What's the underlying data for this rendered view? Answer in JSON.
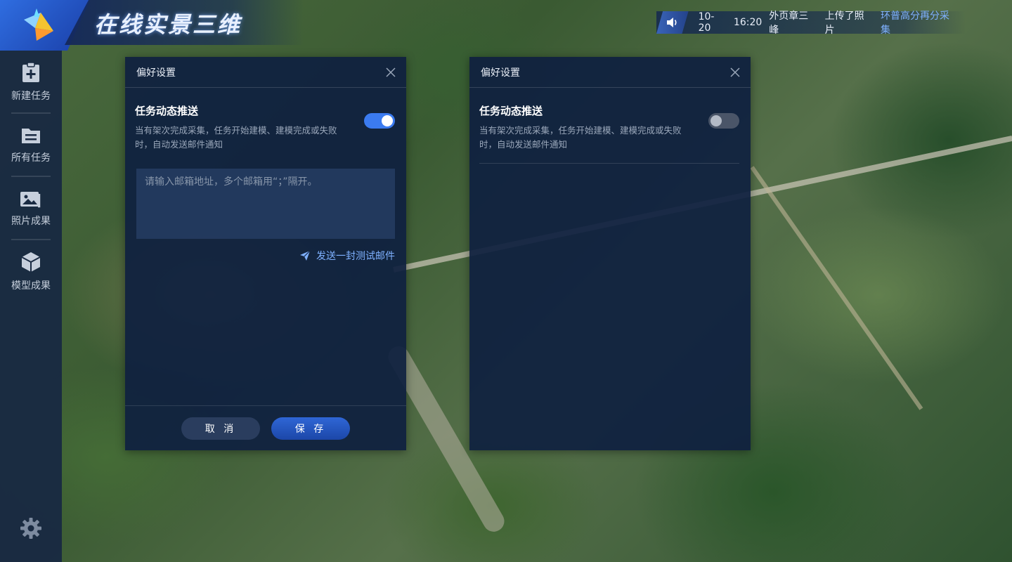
{
  "app": {
    "title": "在线实景三维"
  },
  "notice": {
    "date": "10-20",
    "time": "16:20",
    "user": "外页章三峰",
    "action": "上传了照片",
    "project": "环普高分再分采集"
  },
  "sidebar": {
    "items": [
      {
        "label": "新建任务",
        "icon": "clipboard-plus-icon"
      },
      {
        "label": "所有任务",
        "icon": "list-icon"
      },
      {
        "label": "照片成果",
        "icon": "photos-icon"
      },
      {
        "label": "模型成果",
        "icon": "cube-icon"
      }
    ],
    "settings_icon": "gear-icon"
  },
  "dialog_left": {
    "title": "偏好设置",
    "option": {
      "title": "任务动态推送",
      "desc": "当有架次完成采集，任务开始建模、建模完成或失败时，自动发送邮件通知",
      "enabled": true
    },
    "email": {
      "value": "",
      "placeholder": "请输入邮箱地址，多个邮箱用“；”隔开。"
    },
    "test_mail": "发送一封测试邮件",
    "cancel": "取 消",
    "save": "保 存"
  },
  "dialog_right": {
    "title": "偏好设置",
    "option": {
      "title": "任务动态推送",
      "desc": "当有架次完成采集，任务开始建模、建模完成或失败时，自动发送邮件通知",
      "enabled": false
    }
  },
  "colors": {
    "accent": "#3b7bf0",
    "link": "#7fb1ff",
    "panel": "#0f2040"
  }
}
